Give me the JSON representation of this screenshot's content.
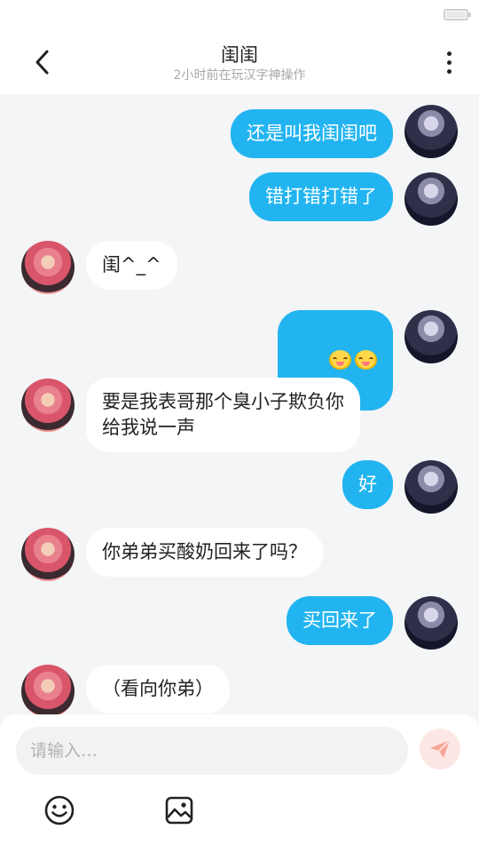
{
  "header": {
    "title": "闺闺",
    "subtitle": "2小时前在玩汉字神操作"
  },
  "messages": [
    {
      "from": "me",
      "text": "还是叫我闺闺吧"
    },
    {
      "from": "me",
      "text": "错打错打错了"
    },
    {
      "from": "other",
      "text": "闺^_^"
    },
    {
      "from": "me",
      "text": "",
      "emoji": [
        "blush-smile-emoji",
        "blush-smile-emoji"
      ]
    },
    {
      "from": "other",
      "text": "要是我表哥那个臭小子欺负你\n给我说一声"
    },
    {
      "from": "me",
      "text": "好"
    },
    {
      "from": "other",
      "text": "你弟弟买酸奶回来了吗？"
    },
    {
      "from": "me",
      "text": "买回来了"
    },
    {
      "from": "other",
      "text": "（看向你弟）"
    }
  ],
  "input": {
    "placeholder": "请输入…",
    "value": ""
  },
  "colors": {
    "my_bubble": "#22b4f0",
    "other_bubble": "#ffffff",
    "background": "#f4f5f7",
    "send_button": "#fde7e4",
    "send_icon": "#f6a699"
  },
  "icons": {
    "back": "chevron-left-icon",
    "more": "more-vertical-icon",
    "send": "paper-plane-icon",
    "emoji": "smiley-icon",
    "image": "image-icon"
  }
}
